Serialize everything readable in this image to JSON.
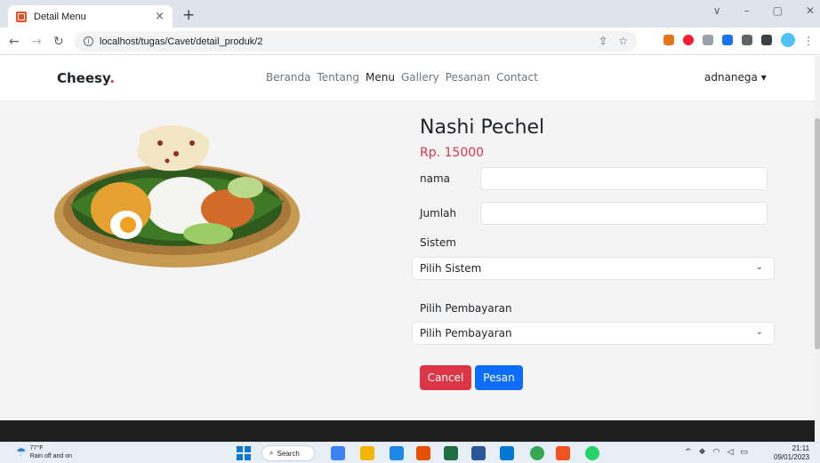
{
  "browser": {
    "tab_title": "Detail Menu",
    "tab_close": "×",
    "new_tab": "+",
    "url": "localhost/tugas/Cavet/detail_produk/2",
    "window_controls": [
      "∨",
      "–",
      "▢",
      "✕"
    ]
  },
  "site": {
    "brand": "Cheesy",
    "brand_dot": ".",
    "nav": [
      "Beranda",
      "Tentang",
      "Menu",
      "Gallery",
      "Pesanan",
      "Contact"
    ],
    "active_nav": "Menu",
    "user": "adnanega ▾"
  },
  "product": {
    "title": "Nashi Pechel",
    "price": "Rp. 15000"
  },
  "form": {
    "nama_label": "nama",
    "jumlah_label": "Jumlah",
    "sistem_label": "Sistem",
    "sistem_selected": "Pilih Sistem",
    "pembayaran_label": "Pilih Pembayaran",
    "pembayaran_selected": "Pilih Pembayaran",
    "cancel_label": "Cancel",
    "pesan_label": "Pesan"
  },
  "taskbar": {
    "temperature": "77°F",
    "weather_desc": "Rain off and on",
    "search_label": "Search",
    "time": "21:11",
    "date": "09/01/2023"
  },
  "colors": {
    "accent_red": "#dc3545",
    "accent_blue": "#0d6efd"
  }
}
